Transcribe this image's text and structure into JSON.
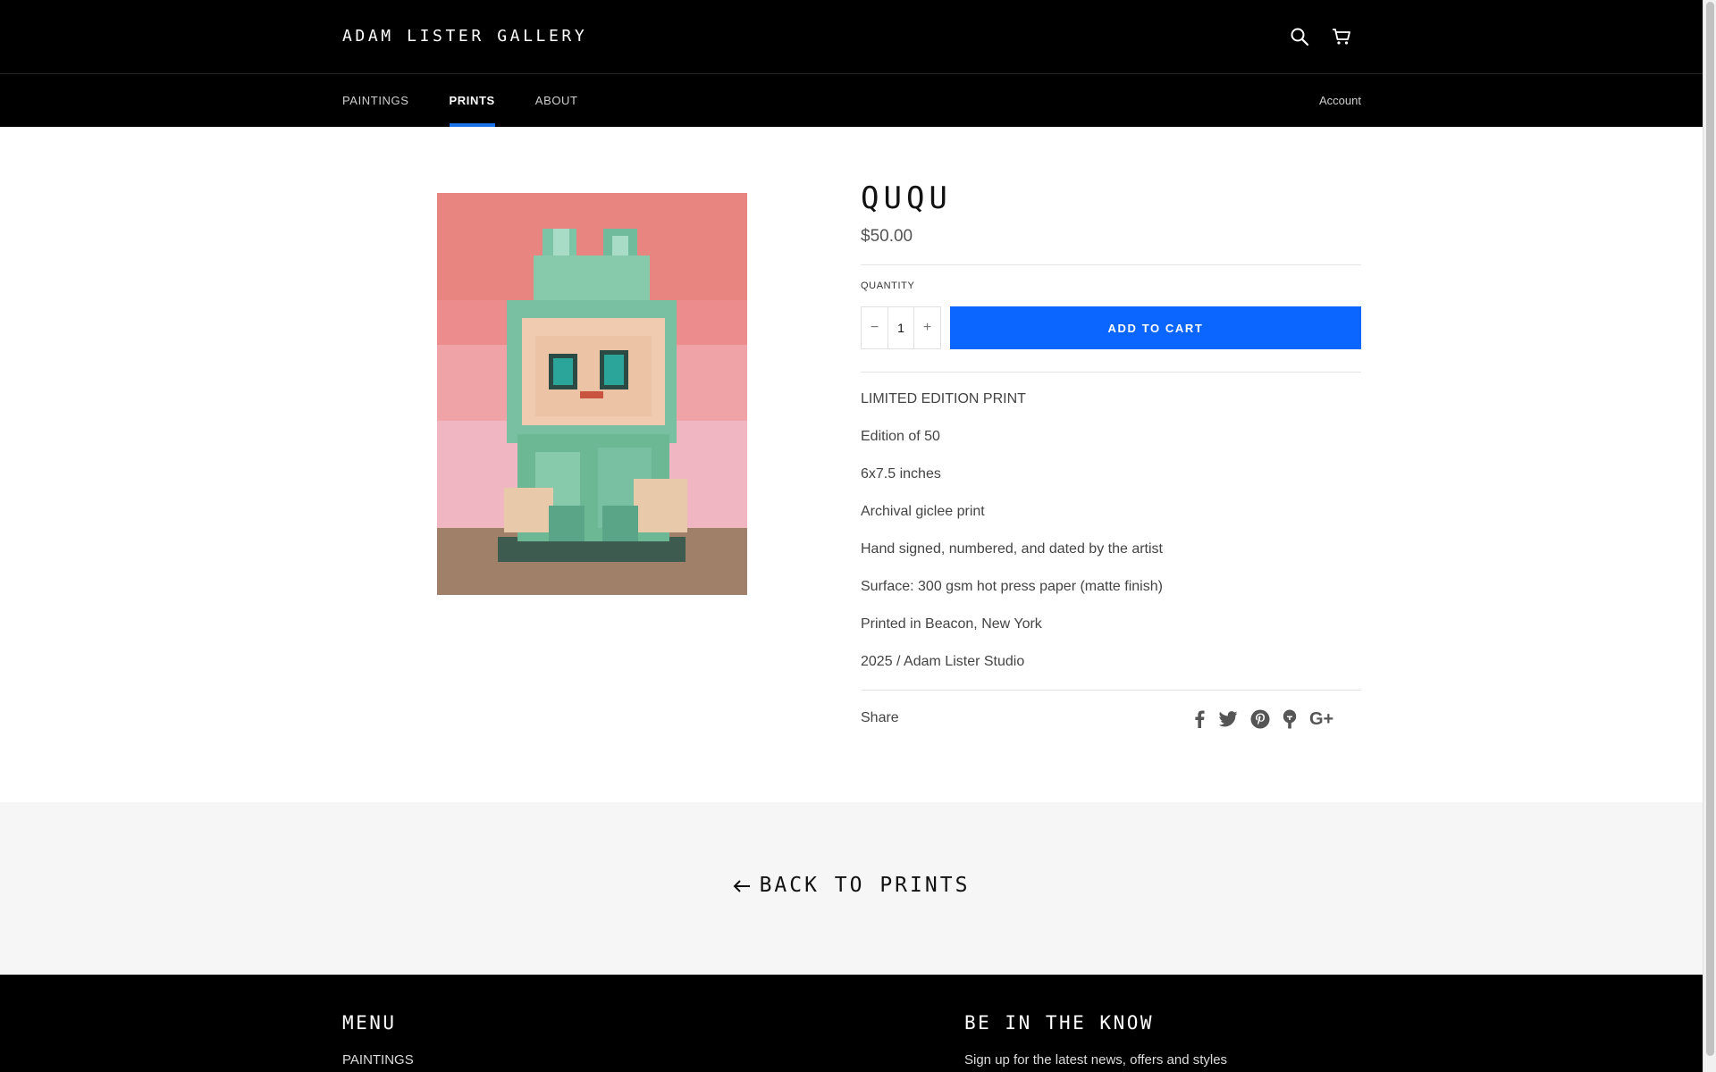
{
  "header": {
    "brand": "ADAM LISTER GALLERY",
    "search_icon": "search-icon",
    "cart_icon": "cart-icon",
    "nav": [
      {
        "label": "PAINTINGS",
        "active": false
      },
      {
        "label": "PRINTS",
        "active": true
      },
      {
        "label": "ABOUT",
        "active": false
      }
    ],
    "account_label": "Account",
    "active_accent": "#1a73e8"
  },
  "product": {
    "title": "QUQU",
    "price": "$50.00",
    "quantity_label": "QUANTITY",
    "quantity_minus": "−",
    "quantity_value": "1",
    "quantity_plus": "+",
    "add_to_cart": "ADD TO CART",
    "button_color": "#0b66ff",
    "description": [
      "LIMITED EDITION PRINT",
      "Edition of 50",
      "6x7.5 inches",
      "Archival giclee print",
      "Hand signed, numbered, and dated by the artist",
      "Surface: 300 gsm hot press paper (matte finish)",
      "Printed in Beacon, New York",
      "2025 / Adam Lister Studio"
    ],
    "share_label": "Share",
    "share_icons": [
      "facebook-icon",
      "twitter-icon",
      "pinterest-icon",
      "fancy-icon",
      "google-plus-icon"
    ],
    "google_plus_text": "G+"
  },
  "back": {
    "label": "BACK TO PRINTS"
  },
  "footer": {
    "menu_heading": "MENU",
    "menu_first_link": "PAINTINGS",
    "newsletter_heading": "BE IN THE KNOW",
    "newsletter_text": "Sign up for the latest news, offers and styles"
  }
}
